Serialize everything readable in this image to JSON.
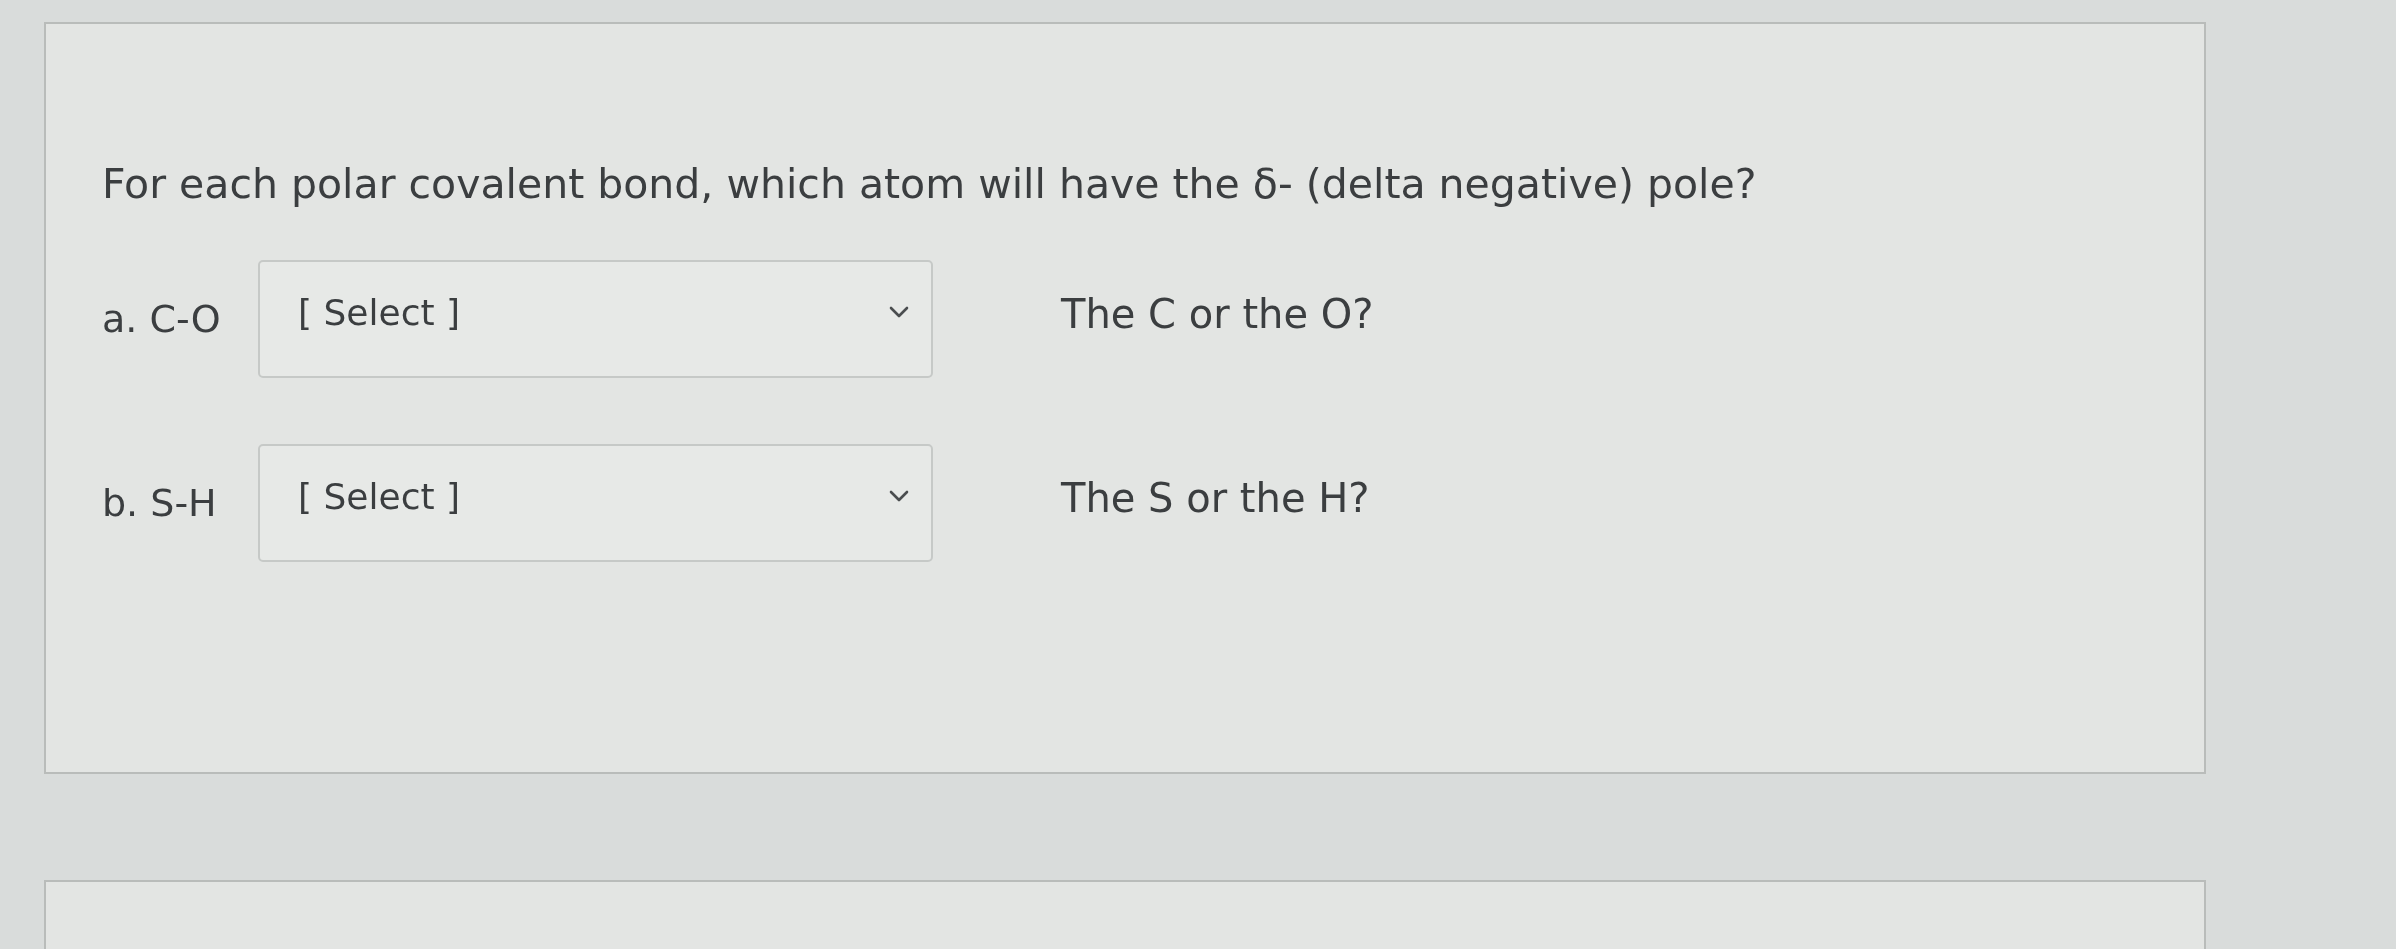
{
  "question": {
    "text": "For each polar covalent bond, which atom will have the δ- (delta negative) pole?"
  },
  "items": [
    {
      "label": "a. C-O",
      "dropdown": {
        "placeholder": "[ Select ]"
      },
      "hint": "The C or the O?"
    },
    {
      "label": "b. S-H",
      "dropdown": {
        "placeholder": "[ Select ]"
      },
      "hint": "The S or the H?"
    }
  ]
}
